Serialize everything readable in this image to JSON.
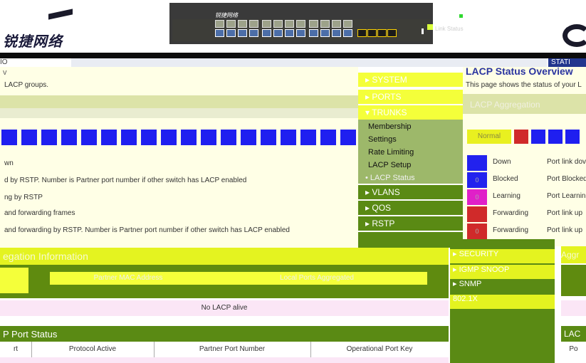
{
  "header": {
    "logo_text": "锐捷网络",
    "device_label": "锐捷网络",
    "legend_label": "Link Status"
  },
  "nav": {
    "left_text": "IO",
    "right_text": "STATI"
  },
  "main": {
    "title_fragment": "v",
    "intro_fragment": "LACP groups.",
    "legend_rows": [
      "wn",
      "d by RSTP. Number is Partner port number if other switch has LACP enabled",
      "ng by RSTP",
      "and forwarding frames",
      "and forwarding by RSTP. Number is Partner port number if other switch has LACP enabled"
    ]
  },
  "overview": {
    "title": "LACP Status Overview",
    "description": "This page shows the status of your L",
    "aggregation_title": "LACP Aggregation",
    "normal_label": "Normal",
    "legend": [
      {
        "state": "Down",
        "desc": "Port link dov",
        "color": "#2222ee",
        "badge": ""
      },
      {
        "state": "Blocked",
        "desc": "Port Blocked",
        "color": "#2222ee",
        "badge": "0"
      },
      {
        "state": "Learning",
        "desc": "Port Learnin",
        "color": "#e020c8",
        "badge": "0"
      },
      {
        "state": "Forwarding",
        "desc": "Port link up",
        "color": "#d02a2a",
        "badge": ""
      },
      {
        "state": "Forwarding",
        "desc": "Port link up",
        "color": "#d02a2a",
        "badge": "0"
      }
    ]
  },
  "sidebar": {
    "items": [
      {
        "label": "SYSTEM",
        "style": "yellow"
      },
      {
        "label": "PORTS",
        "style": "yellow"
      },
      {
        "label": "TRUNKS",
        "style": "yellow"
      }
    ],
    "sub_items": [
      "Membership",
      "Settings",
      "Rate Limiting",
      "LACP Setup",
      "• LACP Status"
    ],
    "lower_items": [
      "VLANS",
      "QOS",
      "RSTP"
    ]
  },
  "popup": {
    "items": [
      "SECURITY",
      "IGMP SNOOP",
      "SNMP",
      "802.1X"
    ]
  },
  "aggregation": {
    "title": "egation Information",
    "right_title": "Aggr",
    "columns": [
      "Partner MAC Address",
      "Local Ports Aggregated"
    ],
    "no_lacp": "No LACP alive"
  },
  "port_status": {
    "title": "P Port Status",
    "right_title": "LAC",
    "columns": [
      "rt",
      "Protocol Active",
      "Partner Port Number",
      "Operational Port Key"
    ],
    "right_column": "Po"
  },
  "colors": {
    "accent_green": "#5a8a14",
    "accent_yellow": "#f4ff3a",
    "port_blue": "#1f1ff0"
  }
}
